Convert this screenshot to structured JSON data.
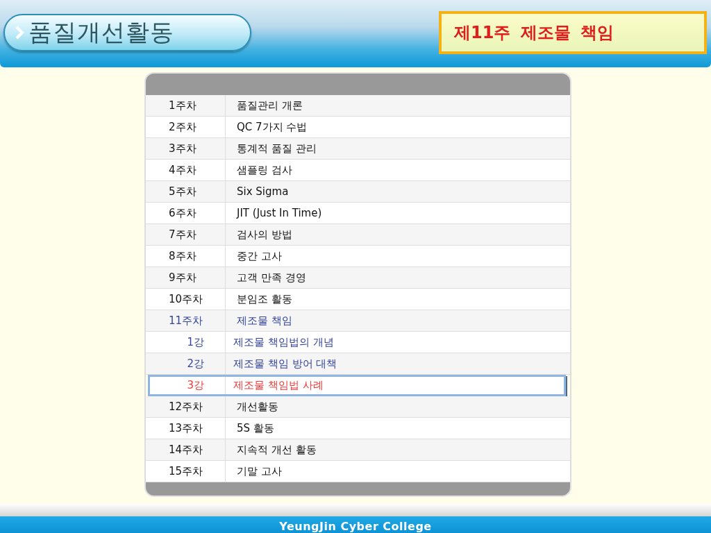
{
  "header": {
    "title": "품질개선활동",
    "current_topic": "제11주 제조물 책임"
  },
  "toc": {
    "rows": [
      {
        "week": "1주차",
        "title": "품질관리 개론",
        "expanded": false
      },
      {
        "week": "2주차",
        "title": "QC 7가지 수법",
        "expanded": false
      },
      {
        "week": "3주차",
        "title": "통계적 품질 관리",
        "expanded": false
      },
      {
        "week": "4주차",
        "title": "샘플링 검사",
        "expanded": false
      },
      {
        "week": "5주차",
        "title": "Six Sigma",
        "expanded": false
      },
      {
        "week": "6주차",
        "title": "JIT (Just In Time)",
        "expanded": false
      },
      {
        "week": "7주차",
        "title": "검사의 방법",
        "expanded": false
      },
      {
        "week": "8주차",
        "title": "중간 고사",
        "expanded": false
      },
      {
        "week": "9주차",
        "title": "고객 만족 경영",
        "expanded": false
      },
      {
        "week": "10주차",
        "title": "분임조 활동",
        "expanded": false
      },
      {
        "week": "11주차",
        "title": "제조물 책임",
        "expanded": true,
        "children": [
          {
            "lecture": "1강",
            "title": "제조물 책임법의 개념",
            "selected": false
          },
          {
            "lecture": "2강",
            "title": "제조물 책임 방어 대책",
            "selected": false
          },
          {
            "lecture": "3강",
            "title": "제조물 책임법 사례",
            "selected": true
          }
        ]
      },
      {
        "week": "12주차",
        "title": "개선활동",
        "expanded": false
      },
      {
        "week": "13주차",
        "title": "5S 활동",
        "expanded": false
      },
      {
        "week": "14주차",
        "title": "지속적 개선 활동",
        "expanded": false
      },
      {
        "week": "15주차",
        "title": "기말 고사",
        "expanded": false
      }
    ]
  },
  "footer": {
    "text": "YeungJin Cyber College"
  }
}
